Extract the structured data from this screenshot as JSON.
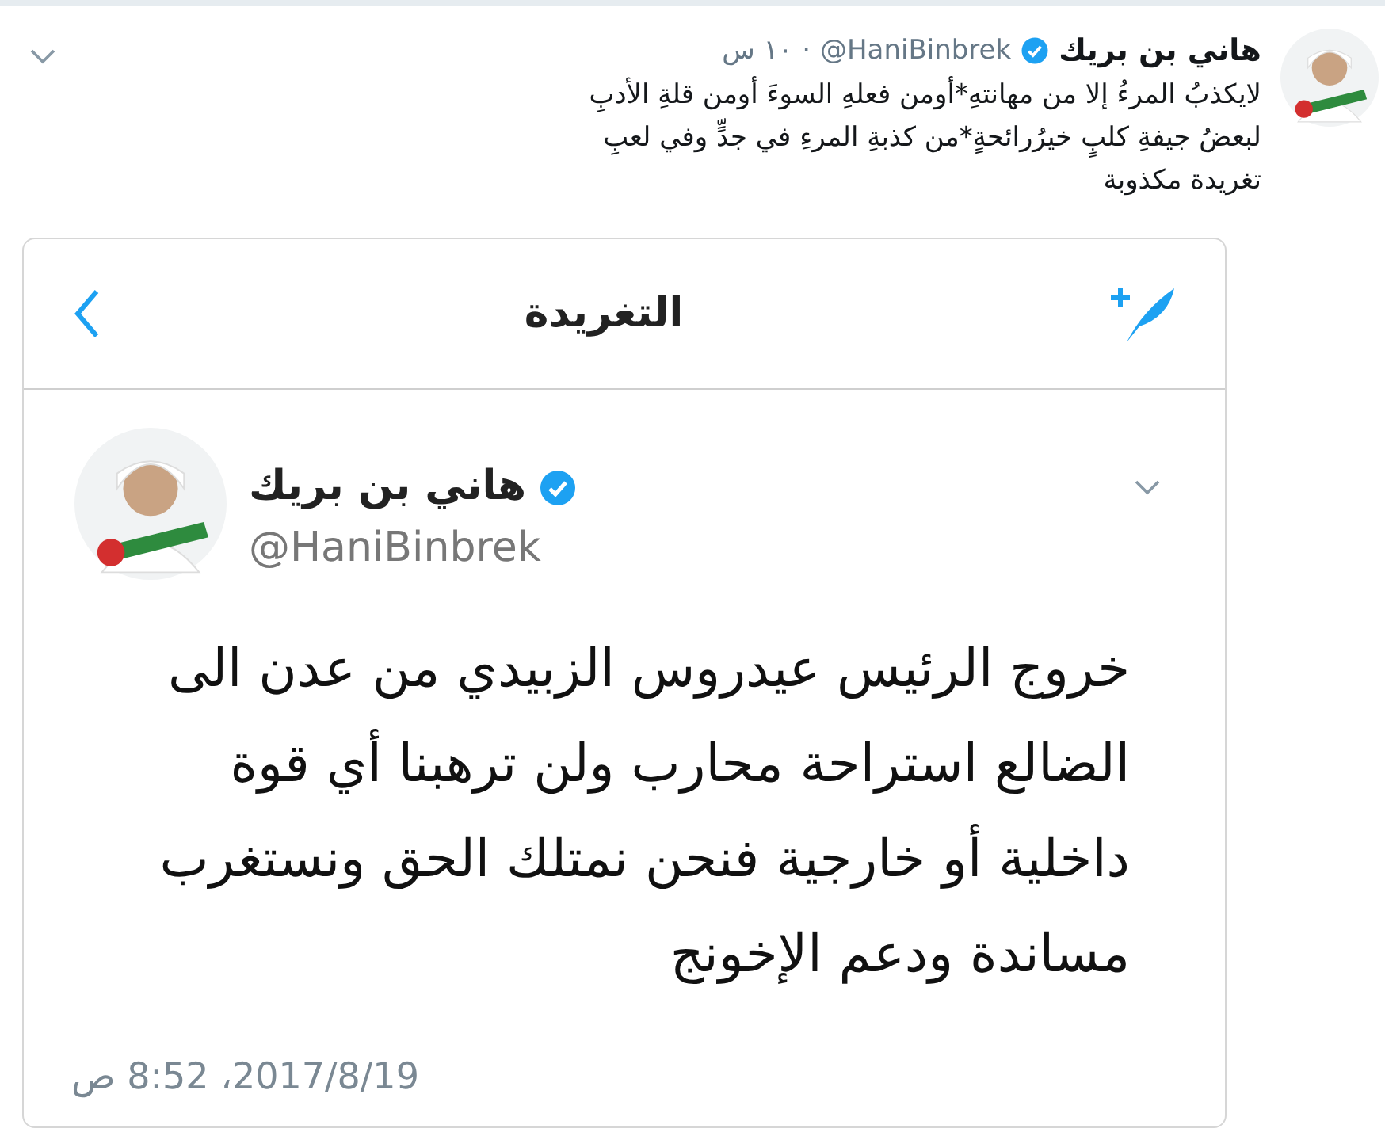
{
  "tweet": {
    "name": "هاني بن بريك",
    "verified": true,
    "handle": "@HaniBinbrek",
    "separator": "·",
    "time": "١٠ س",
    "text_lines": [
      "لايكذبُ المرءُ إلا من مهانتهِ*أومن فعلهِ السوءَ أومن قلةِ الأدبِ",
      "لبعضُ جيفةِ كلبٍ خيرُرائحةٍ*من كذبةِ المرءِ في جدٍّ وفي لعبِ",
      "تغريدة مكذوبة"
    ]
  },
  "embedded_screenshot": {
    "header_title": "التغريدة",
    "name": "هاني بن بريك",
    "verified": true,
    "handle": "@HaniBinbrek",
    "body_lines": [
      "خروج الرئيس عيدروس الزبيدي من عدن الى",
      "الضالع استراحة محارب ولن ترهبنا أي قوة",
      "داخلية أو خارجية فنحن نمتلك الحق ونستغرب",
      "مساندة ودعم الإخونج"
    ],
    "timestamp": "2017/8/19، 8:52 ص"
  }
}
